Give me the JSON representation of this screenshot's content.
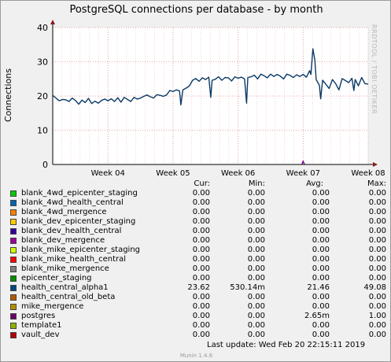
{
  "chart_data": {
    "type": "line",
    "title": "PostgreSQL connections per database - by month",
    "ylabel": "Connections",
    "xlabel": "",
    "ylim": [
      0,
      40
    ],
    "yticks": [
      0,
      10,
      20,
      30,
      40
    ],
    "xlim": [
      3.15,
      8.0
    ],
    "xticks": [
      {
        "value": 4,
        "label": "Week 04"
      },
      {
        "value": 5,
        "label": "Week 05"
      },
      {
        "value": 6,
        "label": "Week 06"
      },
      {
        "value": 7,
        "label": "Week 07"
      },
      {
        "value": 8,
        "label": "Week 08"
      }
    ],
    "grid": true,
    "series": [
      {
        "name": "health_central_alpha1",
        "color": "#0b3a66",
        "points": [
          [
            3.15,
            20.2
          ],
          [
            3.2,
            19.4
          ],
          [
            3.25,
            18.6
          ],
          [
            3.3,
            19.0
          ],
          [
            3.35,
            18.9
          ],
          [
            3.4,
            18.4
          ],
          [
            3.45,
            19.4
          ],
          [
            3.5,
            18.7
          ],
          [
            3.55,
            17.6
          ],
          [
            3.6,
            18.8
          ],
          [
            3.65,
            18.1
          ],
          [
            3.7,
            19.3
          ],
          [
            3.75,
            17.8
          ],
          [
            3.8,
            18.5
          ],
          [
            3.85,
            17.9
          ],
          [
            3.9,
            18.7
          ],
          [
            3.95,
            19.1
          ],
          [
            4.0,
            18.6
          ],
          [
            4.05,
            19.2
          ],
          [
            4.1,
            18.4
          ],
          [
            4.15,
            19.5
          ],
          [
            4.2,
            18.2
          ],
          [
            4.25,
            19.6
          ],
          [
            4.3,
            19.0
          ],
          [
            4.35,
            18.4
          ],
          [
            4.4,
            19.6
          ],
          [
            4.45,
            19.1
          ],
          [
            4.5,
            19.4
          ],
          [
            4.55,
            19.9
          ],
          [
            4.6,
            20.3
          ],
          [
            4.65,
            19.8
          ],
          [
            4.7,
            19.4
          ],
          [
            4.75,
            20.4
          ],
          [
            4.8,
            20.2
          ],
          [
            4.85,
            19.9
          ],
          [
            4.9,
            20.3
          ],
          [
            4.95,
            21.6
          ],
          [
            5.0,
            21.3
          ],
          [
            5.05,
            21.8
          ],
          [
            5.1,
            21.5
          ],
          [
            5.12,
            17.4
          ],
          [
            5.15,
            21.8
          ],
          [
            5.2,
            22.3
          ],
          [
            5.25,
            22.9
          ],
          [
            5.3,
            24.6
          ],
          [
            5.35,
            25.1
          ],
          [
            5.4,
            24.3
          ],
          [
            5.45,
            25.3
          ],
          [
            5.5,
            24.8
          ],
          [
            5.55,
            25.5
          ],
          [
            5.58,
            19.6
          ],
          [
            5.6,
            24.6
          ],
          [
            5.65,
            24.9
          ],
          [
            5.7,
            25.6
          ],
          [
            5.75,
            24.6
          ],
          [
            5.8,
            25.4
          ],
          [
            5.85,
            25.3
          ],
          [
            5.9,
            24.4
          ],
          [
            5.95,
            25.6
          ],
          [
            6.0,
            25.2
          ],
          [
            6.05,
            25.5
          ],
          [
            6.1,
            25.0
          ],
          [
            6.13,
            17.9
          ],
          [
            6.15,
            25.4
          ],
          [
            6.2,
            25.6
          ],
          [
            6.25,
            26.1
          ],
          [
            6.3,
            25.0
          ],
          [
            6.35,
            26.4
          ],
          [
            6.4,
            25.9
          ],
          [
            6.45,
            25.3
          ],
          [
            6.5,
            26.4
          ],
          [
            6.55,
            25.7
          ],
          [
            6.6,
            26.3
          ],
          [
            6.65,
            25.8
          ],
          [
            6.7,
            25.0
          ],
          [
            6.75,
            26.4
          ],
          [
            6.8,
            26.0
          ],
          [
            6.85,
            25.4
          ],
          [
            6.9,
            26.2
          ],
          [
            6.95,
            25.7
          ],
          [
            7.0,
            26.3
          ],
          [
            7.05,
            25.5
          ],
          [
            7.1,
            27.4
          ],
          [
            7.12,
            26.3
          ],
          [
            7.15,
            33.8
          ],
          [
            7.18,
            30.5
          ],
          [
            7.2,
            24.8
          ],
          [
            7.25,
            23.1
          ],
          [
            7.27,
            19.2
          ],
          [
            7.3,
            24.6
          ],
          [
            7.35,
            23.4
          ],
          [
            7.4,
            22.2
          ],
          [
            7.45,
            24.8
          ],
          [
            7.5,
            23.6
          ],
          [
            7.55,
            21.8
          ],
          [
            7.6,
            25.1
          ],
          [
            7.65,
            24.5
          ],
          [
            7.7,
            23.9
          ],
          [
            7.75,
            25.2
          ],
          [
            7.78,
            21.6
          ],
          [
            7.8,
            24.8
          ],
          [
            7.85,
            23.0
          ],
          [
            7.9,
            25.4
          ],
          [
            7.95,
            23.6
          ],
          [
            8.0,
            23.5
          ]
        ]
      },
      {
        "name": "postgres",
        "color": "#7a009c",
        "points": [
          [
            6.98,
            0
          ],
          [
            7.0,
            1.0
          ],
          [
            7.02,
            0
          ]
        ]
      }
    ]
  },
  "legend": {
    "headers": {
      "cur": "Cur:",
      "min": "Min:",
      "avg": "Avg:",
      "max": "Max:"
    },
    "rows": [
      {
        "name": "blank_4wd_epicenter_staging",
        "color": "#00cc00",
        "cur": "0.00",
        "min": "0.00",
        "avg": "0.00",
        "max": "0.00"
      },
      {
        "name": "blank_4wd_health_central",
        "color": "#0066b3",
        "cur": "0.00",
        "min": "0.00",
        "avg": "0.00",
        "max": "0.00"
      },
      {
        "name": "blank_4wd_mergence",
        "color": "#ff8000",
        "cur": "0.00",
        "min": "0.00",
        "avg": "0.00",
        "max": "0.00"
      },
      {
        "name": "blank_dev_epicenter_staging",
        "color": "#ffcc00",
        "cur": "0.00",
        "min": "0.00",
        "avg": "0.00",
        "max": "0.00"
      },
      {
        "name": "blank_dev_health_central",
        "color": "#330099",
        "cur": "0.00",
        "min": "0.00",
        "avg": "0.00",
        "max": "0.00"
      },
      {
        "name": "blank_dev_mergence",
        "color": "#990099",
        "cur": "0.00",
        "min": "0.00",
        "avg": "0.00",
        "max": "0.00"
      },
      {
        "name": "blank_mike_epicenter_staging",
        "color": "#ccff00",
        "cur": "0.00",
        "min": "0.00",
        "avg": "0.00",
        "max": "0.00"
      },
      {
        "name": "blank_mike_health_central",
        "color": "#ff0000",
        "cur": "0.00",
        "min": "0.00",
        "avg": "0.00",
        "max": "0.00"
      },
      {
        "name": "blank_mike_mergence",
        "color": "#808080",
        "cur": "0.00",
        "min": "0.00",
        "avg": "0.00",
        "max": "0.00"
      },
      {
        "name": "epicenter_staging",
        "color": "#008f00",
        "cur": "0.00",
        "min": "0.00",
        "avg": "0.00",
        "max": "0.00"
      },
      {
        "name": "health_central_alpha1",
        "color": "#00487d",
        "cur": "23.62",
        "min": "530.14m",
        "avg": "21.46",
        "max": "49.08"
      },
      {
        "name": "health_central_old_beta",
        "color": "#b35a00",
        "cur": "0.00",
        "min": "0.00",
        "avg": "0.00",
        "max": "0.00"
      },
      {
        "name": "mike_mergence",
        "color": "#b38f00",
        "cur": "0.00",
        "min": "0.00",
        "avg": "0.00",
        "max": "0.00"
      },
      {
        "name": "postgres",
        "color": "#6b006b",
        "cur": "0.00",
        "min": "0.00",
        "avg": "2.65m",
        "max": "1.00"
      },
      {
        "name": "template1",
        "color": "#8fb300",
        "cur": "0.00",
        "min": "0.00",
        "avg": "0.00",
        "max": "0.00"
      },
      {
        "name": "vault_dev",
        "color": "#b30000",
        "cur": "0.00",
        "min": "0.00",
        "avg": "0.00",
        "max": "0.00"
      }
    ]
  },
  "footer": {
    "last_update": "Last update:  Wed Feb 20 22:15:11 2019",
    "version": "Munin 1.4.6"
  },
  "watermark": "RRDTOOL / TOBI OETIKER"
}
